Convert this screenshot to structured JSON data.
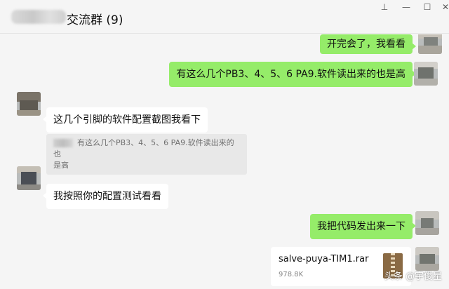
{
  "window": {
    "group_name_suffix": "交流群",
    "member_count": "(9)",
    "controls": {
      "pin_icon": "⊥",
      "minimize_icon": "—",
      "maximize_icon": "☐",
      "close_icon": "✕"
    }
  },
  "messages": [
    {
      "side": "right",
      "text": "开完会了，我看看"
    },
    {
      "side": "right",
      "text": "有这么几个PB3、4、5、6  PA9.软件读出来的也是高"
    },
    {
      "side": "left",
      "text": "这几个引脚的软件配置截图我看下",
      "quote_line1": "有这么几个PB3、4、5、6  PA9.软件读出来的也",
      "quote_line2": "是高"
    },
    {
      "side": "left",
      "text": "我按照你的配置测试看看"
    },
    {
      "side": "right",
      "text": "我把代码发出来一下"
    },
    {
      "side": "right",
      "file_name": "salve-puya-TIM1.rar",
      "file_size": "978.8K"
    }
  ],
  "watermark": "头条 @宇俊星",
  "colors": {
    "sent_bubble": "#95ec69",
    "received_bubble": "#ffffff",
    "background": "#f5f5f5"
  }
}
